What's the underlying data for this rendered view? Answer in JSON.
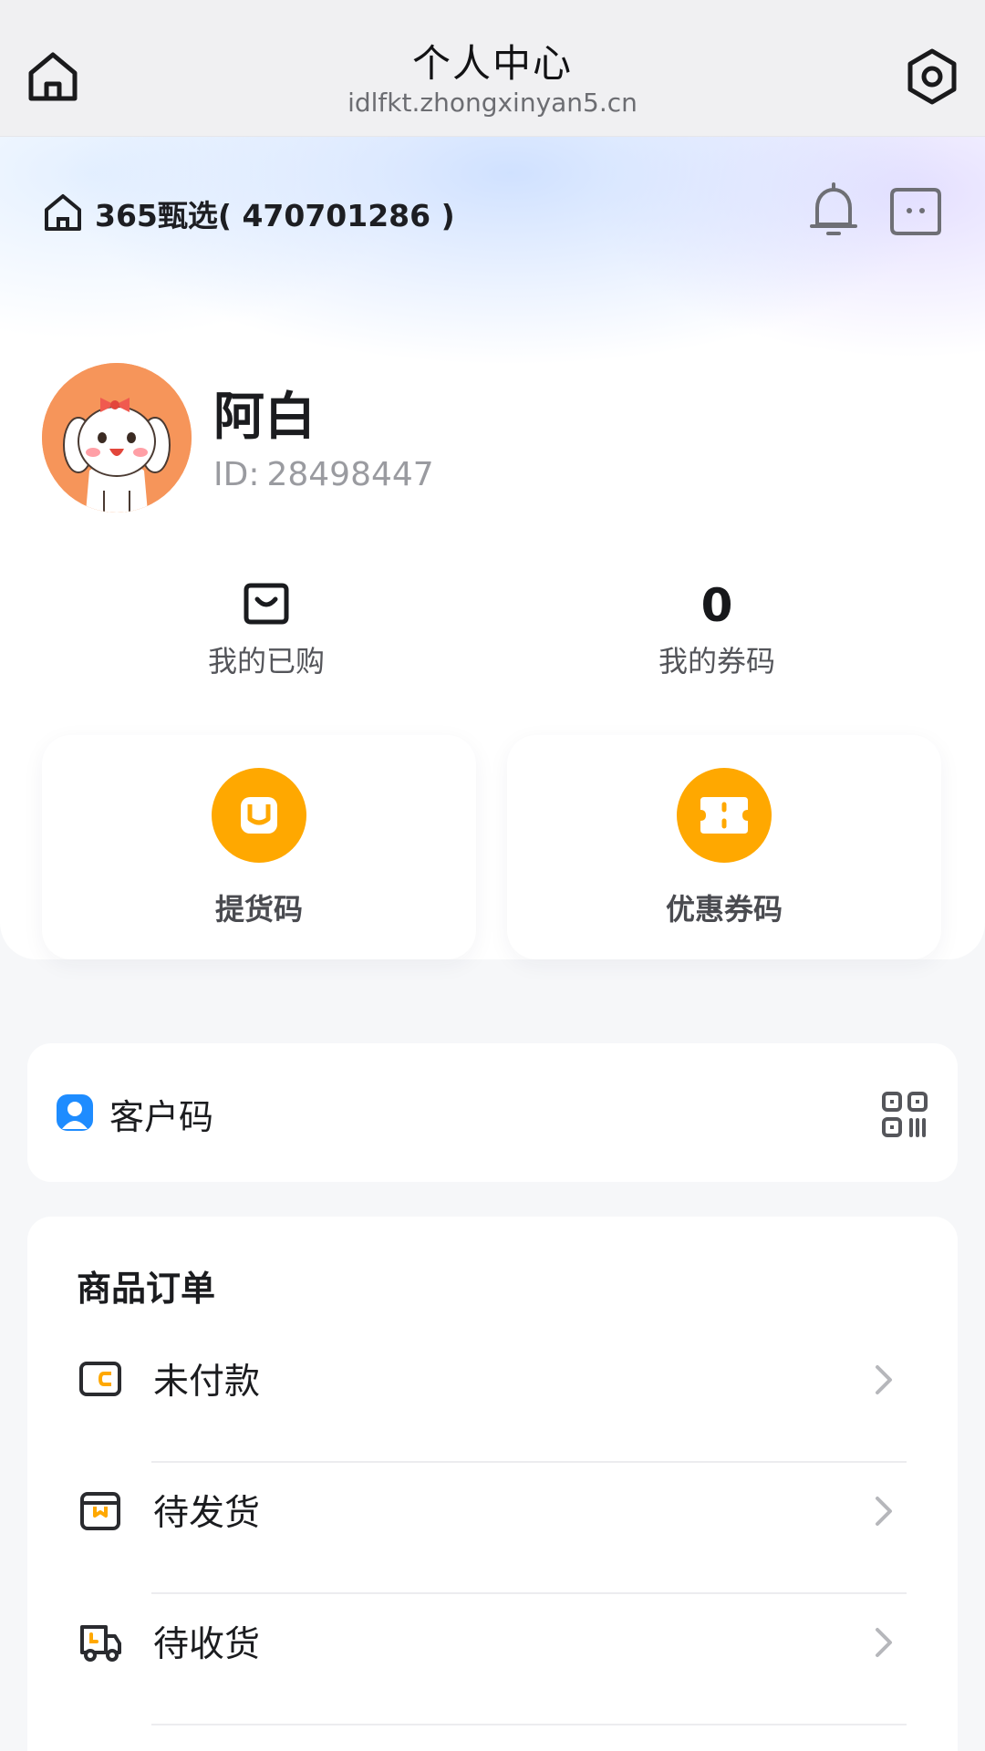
{
  "header": {
    "title": "个人中心",
    "url": "idlfkt.zhongxinyan5.cn"
  },
  "store": {
    "name": "365甄选( 470701286 )"
  },
  "user": {
    "name": "阿白",
    "id_label": "ID:",
    "id_value": "28498447"
  },
  "stats": {
    "purchased_label": "我的已购",
    "coupons_count": "0",
    "coupons_label": "我的券码"
  },
  "quick_actions": {
    "pickup_label": "提货码",
    "coupon_label": "优惠券码"
  },
  "customer": {
    "label": "客户码"
  },
  "orders": {
    "title": "商品订单",
    "items": [
      {
        "label": "未付款",
        "icon": "wallet-icon"
      },
      {
        "label": "待发货",
        "icon": "box-icon"
      },
      {
        "label": "待收货",
        "icon": "truck-icon"
      }
    ]
  },
  "colors": {
    "accent": "#ffa800",
    "customer_icon": "#1e8cff"
  }
}
